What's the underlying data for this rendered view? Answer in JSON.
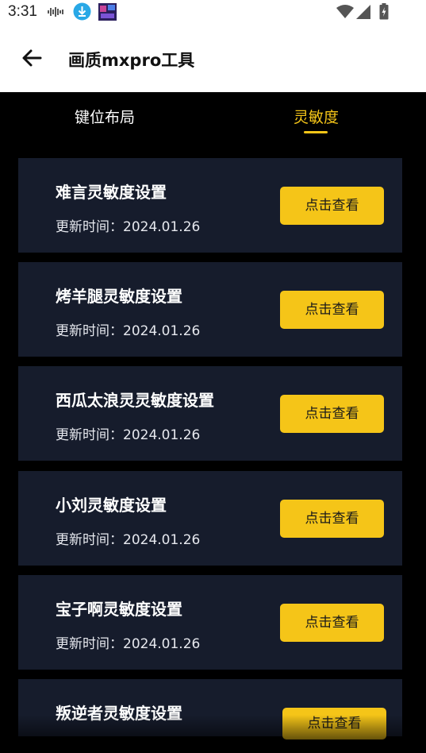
{
  "status_bar": {
    "time": "3:31",
    "icons": [
      "audio-wave-icon",
      "download-icon",
      "app-thumbnail-icon",
      "wifi-icon",
      "signal-icon",
      "battery-icon"
    ]
  },
  "app_bar": {
    "title": "画质mxpro工具",
    "back_icon": "arrow-left-icon"
  },
  "tabs": [
    {
      "label": "键位布局",
      "active": false
    },
    {
      "label": "灵敏度",
      "active": true
    }
  ],
  "colors": {
    "accent": "#f5c518",
    "card_bg": "#161c2c",
    "page_bg": "#000000"
  },
  "cards": [
    {
      "title": "难言灵敏度设置",
      "updated": "更新时间：2024.01.26",
      "button": "点击查看"
    },
    {
      "title": "烤羊腿灵敏度设置",
      "updated": "更新时间：2024.01.26",
      "button": "点击查看"
    },
    {
      "title": "西瓜太浪灵灵敏度设置",
      "updated": "更新时间：2024.01.26",
      "button": "点击查看"
    },
    {
      "title": "小刘灵敏度设置",
      "updated": "更新时间：2024.01.26",
      "button": "点击查看"
    },
    {
      "title": "宝子啊灵敏度设置",
      "updated": "更新时间：2024.01.26",
      "button": "点击查看"
    },
    {
      "title": "叛逆者灵敏度设置",
      "button": "点击查看"
    }
  ]
}
